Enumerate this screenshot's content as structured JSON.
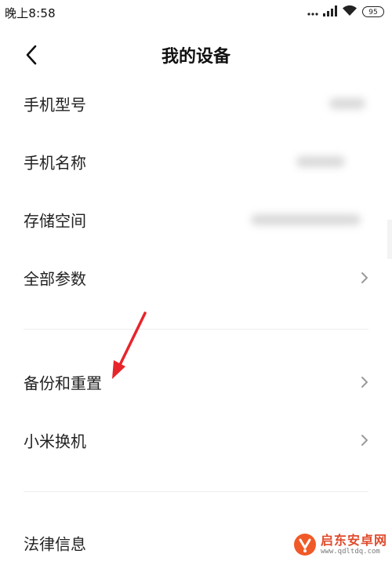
{
  "status_bar": {
    "time": "晚上8:58",
    "signal_icon": "signal-icon",
    "wifi_icon": "wifi-icon",
    "battery_level": "95"
  },
  "header": {
    "back_icon": "back-arrow-icon",
    "title": "我的设备"
  },
  "section_info": {
    "items": [
      {
        "label": "手机型号",
        "value_visible": false
      },
      {
        "label": "手机名称",
        "value_visible": false
      },
      {
        "label": "存储空间",
        "value_visible": false
      },
      {
        "label": "全部参数",
        "has_chevron": true
      }
    ]
  },
  "section_actions": {
    "items": [
      {
        "label": "备份和重置",
        "has_chevron": true
      },
      {
        "label": "小米换机",
        "has_chevron": true
      }
    ]
  },
  "section_legal": {
    "items": [
      {
        "label": "法律信息"
      }
    ]
  },
  "annotation": {
    "arrow_color": "#e8242b"
  },
  "watermark": {
    "brand": "启东安卓网",
    "url": "www.qdltdq.com",
    "logo_color": "#f05a28"
  },
  "colors": {
    "background": "#ffffff",
    "text": "#222222",
    "chevron": "#9a9a9a",
    "divider": "#eeeeee"
  }
}
